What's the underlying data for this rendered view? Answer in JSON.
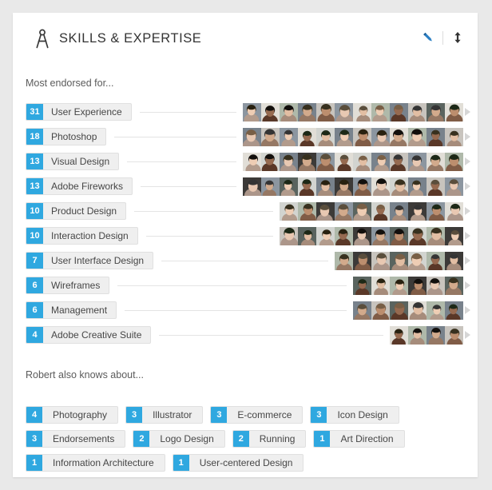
{
  "header": {
    "title": "SKILLS & EXPERTISE",
    "icon": "compass-icon",
    "edit_icon": "pencil-icon",
    "reorder_icon": "vertical-arrows-icon",
    "accent_color": "#2fa8e0"
  },
  "sections": {
    "most_endorsed_label": "Most endorsed for...",
    "also_knows_label": "Robert also knows about..."
  },
  "skills": [
    {
      "count": "31",
      "name": "User Experience",
      "endorser_count": 12
    },
    {
      "count": "18",
      "name": "Photoshop",
      "endorser_count": 12
    },
    {
      "count": "13",
      "name": "Visual Design",
      "endorser_count": 12
    },
    {
      "count": "13",
      "name": "Adobe Fireworks",
      "endorser_count": 12
    },
    {
      "count": "10",
      "name": "Product Design",
      "endorser_count": 10
    },
    {
      "count": "10",
      "name": "Interaction Design",
      "endorser_count": 10
    },
    {
      "count": "7",
      "name": "User Interface Design",
      "endorser_count": 7
    },
    {
      "count": "6",
      "name": "Wireframes",
      "endorser_count": 6
    },
    {
      "count": "6",
      "name": "Management",
      "endorser_count": 6
    },
    {
      "count": "4",
      "name": "Adobe Creative Suite",
      "endorser_count": 4
    }
  ],
  "also_knows": [
    [
      {
        "count": "4",
        "name": "Photography"
      },
      {
        "count": "3",
        "name": "Illustrator"
      },
      {
        "count": "3",
        "name": "E-commerce"
      },
      {
        "count": "3",
        "name": "Icon Design"
      }
    ],
    [
      {
        "count": "3",
        "name": "Endorsements"
      },
      {
        "count": "2",
        "name": "Logo Design"
      },
      {
        "count": "2",
        "name": "Running"
      },
      {
        "count": "1",
        "name": "Art Direction"
      }
    ],
    [
      {
        "count": "1",
        "name": "Information Architecture"
      },
      {
        "count": "1",
        "name": "User-centered Design"
      }
    ]
  ]
}
